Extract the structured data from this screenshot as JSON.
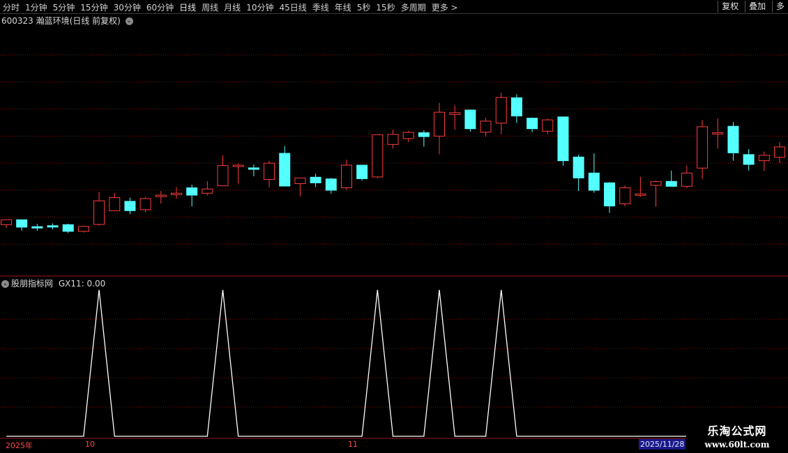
{
  "toolbar": {
    "periods": [
      "分时",
      "1分钟",
      "5分钟",
      "15分钟",
      "30分钟",
      "60分钟",
      "日线",
      "周线",
      "月线",
      "10分钟",
      "45日线",
      "季线",
      "年线",
      "5秒",
      "15秒",
      "多周期",
      "更多 >"
    ],
    "active_period": "日线",
    "right_buttons": [
      "复权",
      "叠加",
      "多"
    ]
  },
  "chart_header": {
    "code": "600323",
    "name": "瀚蓝环境",
    "mode": "(日线 前复权)"
  },
  "indicator_header": {
    "name": "股朋指标网",
    "value_text": "GX11: 0.00"
  },
  "time_axis": {
    "labels": [
      "2025年",
      "10",
      "11"
    ],
    "last_date": "2025/11/28"
  },
  "watermark": {
    "title": "乐淘公式网",
    "url": "www.60lt.com"
  },
  "colors": {
    "up": "#ff3c3c",
    "down": "#54ffff",
    "grid": "#7a1010",
    "indicator_line": "#ffffff"
  },
  "chart_data": [
    {
      "type": "candlestick",
      "title": "600323 瀚蓝环境(日线 前复权)",
      "note": "price scale not printed; values in relative units",
      "candles": [
        {
          "o": 20.0,
          "h": 21.4,
          "l": 18.7,
          "c": 22.0,
          "up": true
        },
        {
          "o": 22.0,
          "h": 22.0,
          "l": 17.5,
          "c": 19.0,
          "up": false
        },
        {
          "o": 19.2,
          "h": 20.3,
          "l": 17.5,
          "c": 18.8,
          "up": false
        },
        {
          "o": 19.6,
          "h": 20.5,
          "l": 18.1,
          "c": 19.1,
          "up": false
        },
        {
          "o": 20.0,
          "h": 20.4,
          "l": 16.6,
          "c": 17.3,
          "up": false
        },
        {
          "o": 17.3,
          "h": 19.1,
          "l": 16.8,
          "c": 19.3,
          "up": true
        },
        {
          "o": 20.1,
          "h": 33.3,
          "l": 19.6,
          "c": 29.7,
          "up": true
        },
        {
          "o": 25.7,
          "h": 32.9,
          "l": 25.5,
          "c": 31.0,
          "up": true
        },
        {
          "o": 29.5,
          "h": 31.0,
          "l": 24.3,
          "c": 25.7,
          "up": false
        },
        {
          "o": 26.1,
          "h": 31.3,
          "l": 25.0,
          "c": 30.6,
          "up": true
        },
        {
          "o": 31.5,
          "h": 33.7,
          "l": 28.6,
          "c": 32.0,
          "up": true
        },
        {
          "o": 32.2,
          "h": 35.3,
          "l": 30.6,
          "c": 32.8,
          "up": true
        },
        {
          "o": 35.0,
          "h": 36.3,
          "l": 27.4,
          "c": 32.0,
          "up": false
        },
        {
          "o": 32.8,
          "h": 37.7,
          "l": 31.9,
          "c": 34.5,
          "up": true
        },
        {
          "o": 35.8,
          "h": 48.2,
          "l": 35.8,
          "c": 44.0,
          "up": true
        },
        {
          "o": 44.0,
          "h": 44.8,
          "l": 36.7,
          "c": 44.2,
          "up": true
        },
        {
          "o": 43.1,
          "h": 44.5,
          "l": 39.7,
          "c": 42.5,
          "up": false
        },
        {
          "o": 38.4,
          "h": 46.0,
          "l": 35.2,
          "c": 45.0,
          "up": true
        },
        {
          "o": 49.0,
          "h": 52.0,
          "l": 41.5,
          "c": 35.7,
          "up": false
        },
        {
          "o": 36.7,
          "h": 38.5,
          "l": 31.5,
          "c": 39.0,
          "up": true
        },
        {
          "o": 39.3,
          "h": 40.7,
          "l": 35.3,
          "c": 37.0,
          "up": false
        },
        {
          "o": 38.6,
          "h": 39.0,
          "l": 32.6,
          "c": 34.0,
          "up": false
        },
        {
          "o": 35.0,
          "h": 46.4,
          "l": 34.0,
          "c": 44.2,
          "up": true
        },
        {
          "o": 44.2,
          "h": 44.2,
          "l": 37.9,
          "c": 38.7,
          "up": false
        },
        {
          "o": 39.4,
          "h": 54.8,
          "l": 38.9,
          "c": 56.6,
          "up": true
        },
        {
          "o": 52.6,
          "h": 58.6,
          "l": 51.0,
          "c": 56.7,
          "up": true
        },
        {
          "o": 55.0,
          "h": 58.2,
          "l": 53.6,
          "c": 57.5,
          "up": true
        },
        {
          "o": 57.4,
          "h": 58.4,
          "l": 51.7,
          "c": 55.8,
          "up": false
        },
        {
          "o": 56.0,
          "h": 69.5,
          "l": 48.6,
          "c": 65.7,
          "up": true
        },
        {
          "o": 64.8,
          "h": 68.5,
          "l": 58.6,
          "c": 65.5,
          "up": true
        },
        {
          "o": 66.6,
          "h": 66.6,
          "l": 57.8,
          "c": 59.0,
          "up": false
        },
        {
          "o": 57.6,
          "h": 63.5,
          "l": 55.8,
          "c": 62.1,
          "up": true
        },
        {
          "o": 61.3,
          "h": 73.6,
          "l": 56.8,
          "c": 71.7,
          "up": true
        },
        {
          "o": 71.6,
          "h": 73.0,
          "l": 61.3,
          "c": 64.2,
          "up": false
        },
        {
          "o": 63.3,
          "h": 63.6,
          "l": 57.6,
          "c": 59.0,
          "up": false
        },
        {
          "o": 58.0,
          "h": 63.1,
          "l": 56.8,
          "c": 62.6,
          "up": true
        },
        {
          "o": 63.8,
          "h": 64.0,
          "l": 44.0,
          "c": 46.0,
          "up": false
        },
        {
          "o": 47.5,
          "h": 48.5,
          "l": 33.7,
          "c": 39.0,
          "up": false
        },
        {
          "o": 41.0,
          "h": 49.0,
          "l": 33.0,
          "c": 34.0,
          "up": false
        },
        {
          "o": 37.0,
          "h": 37.3,
          "l": 24.8,
          "c": 27.6,
          "up": false
        },
        {
          "o": 28.5,
          "h": 36.0,
          "l": 27.5,
          "c": 35.0,
          "up": true
        },
        {
          "o": 32.5,
          "h": 39.5,
          "l": 31.3,
          "c": 32.5,
          "up": true
        },
        {
          "o": 36.0,
          "h": 38.0,
          "l": 27.3,
          "c": 37.5,
          "up": true
        },
        {
          "o": 37.6,
          "h": 42.0,
          "l": 35.5,
          "c": 35.6,
          "up": false
        },
        {
          "o": 35.6,
          "h": 44.0,
          "l": 34.8,
          "c": 41.0,
          "up": true
        },
        {
          "o": 43.0,
          "h": 62.5,
          "l": 38.5,
          "c": 59.8,
          "up": true
        },
        {
          "o": 57.2,
          "h": 63.2,
          "l": 51.0,
          "c": 57.4,
          "up": true
        },
        {
          "o": 60.0,
          "h": 61.7,
          "l": 46.0,
          "c": 49.2,
          "up": false
        },
        {
          "o": 48.5,
          "h": 50.7,
          "l": 42.0,
          "c": 44.5,
          "up": false
        },
        {
          "o": 46.0,
          "h": 49.7,
          "l": 41.8,
          "c": 48.2,
          "up": true
        },
        {
          "o": 47.4,
          "h": 53.5,
          "l": 45.0,
          "c": 51.6,
          "up": true
        }
      ]
    },
    {
      "type": "line",
      "title": "股朋指标网 GX11: 0.00",
      "series": [
        {
          "name": "GX11",
          "spikes_at_index": [
            6,
            14,
            24,
            28,
            32
          ],
          "values": [
            0,
            0,
            0,
            0,
            0,
            0,
            1,
            0,
            0,
            0,
            0,
            0,
            0,
            0,
            1,
            0,
            0,
            0,
            0,
            0,
            0,
            0,
            0,
            0,
            1,
            0,
            0,
            0,
            1,
            0,
            0,
            0,
            1,
            0,
            0,
            0,
            0,
            0,
            0,
            0,
            0,
            0,
            0,
            0,
            0,
            0,
            0,
            0,
            0,
            0,
            0
          ]
        }
      ]
    }
  ]
}
